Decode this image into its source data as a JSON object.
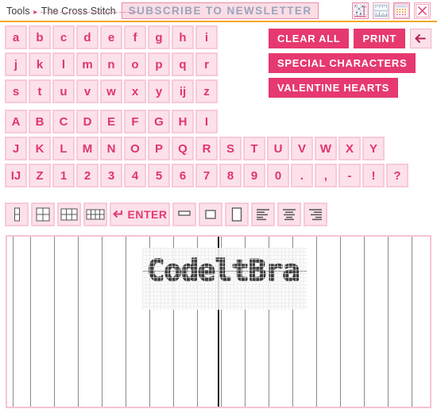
{
  "topbar": {
    "breadcrumb_root": "Tools",
    "breadcrumb_separator": "▸",
    "breadcrumb_current": "The Cross Stitch",
    "subscribe_label": "SUBSCRIBE TO NEWSLETTER",
    "icons": [
      {
        "name": "pattern-chart-icon",
        "title": "Pattern chart"
      },
      {
        "name": "ruler-icon",
        "title": "Ruler / measure"
      },
      {
        "name": "color-palette-grid-icon",
        "title": "Color grid"
      },
      {
        "name": "close-icon",
        "title": "Close"
      }
    ]
  },
  "keyboard": {
    "rows": [
      [
        "a",
        "b",
        "c",
        "d",
        "e",
        "f",
        "g",
        "h",
        "i"
      ],
      [
        "j",
        "k",
        "l",
        "m",
        "n",
        "o",
        "p",
        "q",
        "r"
      ],
      [
        "s",
        "t",
        "u",
        "v",
        "w",
        "x",
        "y",
        "ij",
        "z"
      ],
      [
        "A",
        "B",
        "C",
        "D",
        "E",
        "F",
        "G",
        "H",
        "I"
      ],
      [
        "J",
        "K",
        "L",
        "M",
        "N",
        "O",
        "P",
        "Q",
        "R",
        "S",
        "T",
        "U",
        "V",
        "W",
        "X",
        "Y"
      ],
      [
        "IJ",
        "Z",
        "1",
        "2",
        "3",
        "4",
        "5",
        "6",
        "7",
        "8",
        "9",
        "0",
        ".",
        ",",
        "-",
        "!",
        "?"
      ]
    ]
  },
  "actions": {
    "clear_all": "CLEAR ALL",
    "print": "PRINT",
    "back_icon": "arrow-left-icon",
    "special_characters": "SPECIAL CHARACTERS",
    "valentine_hearts": "VALENTINE HEARTS"
  },
  "tools": {
    "items": [
      {
        "name": "grid-1x2-button",
        "label": ""
      },
      {
        "name": "grid-2x2-button",
        "label": ""
      },
      {
        "name": "grid-3x2-button",
        "label": ""
      },
      {
        "name": "grid-4x2-button",
        "label": ""
      },
      {
        "name": "enter-button",
        "label": "ENTER"
      },
      {
        "name": "shape-wide-button",
        "label": ""
      },
      {
        "name": "shape-medium-button",
        "label": ""
      },
      {
        "name": "shape-tall-button",
        "label": ""
      },
      {
        "name": "align-left-button",
        "label": ""
      },
      {
        "name": "align-center-button",
        "label": ""
      },
      {
        "name": "align-right-button",
        "label": ""
      }
    ],
    "enter_label": "ENTER"
  },
  "canvas": {
    "stitched_text": "CodeltBra",
    "columns": 18,
    "center_guide": true
  },
  "colors": {
    "accent": "#e5396f",
    "key_fill": "#fce1ea",
    "key_border": "#f8c9d9",
    "key_text": "#e0356f",
    "top_rule": "#f5a623",
    "subscribe_text": "#9aa4bb",
    "canvas_border": "#f7c3d4",
    "stitch": "#3d3d3d"
  }
}
